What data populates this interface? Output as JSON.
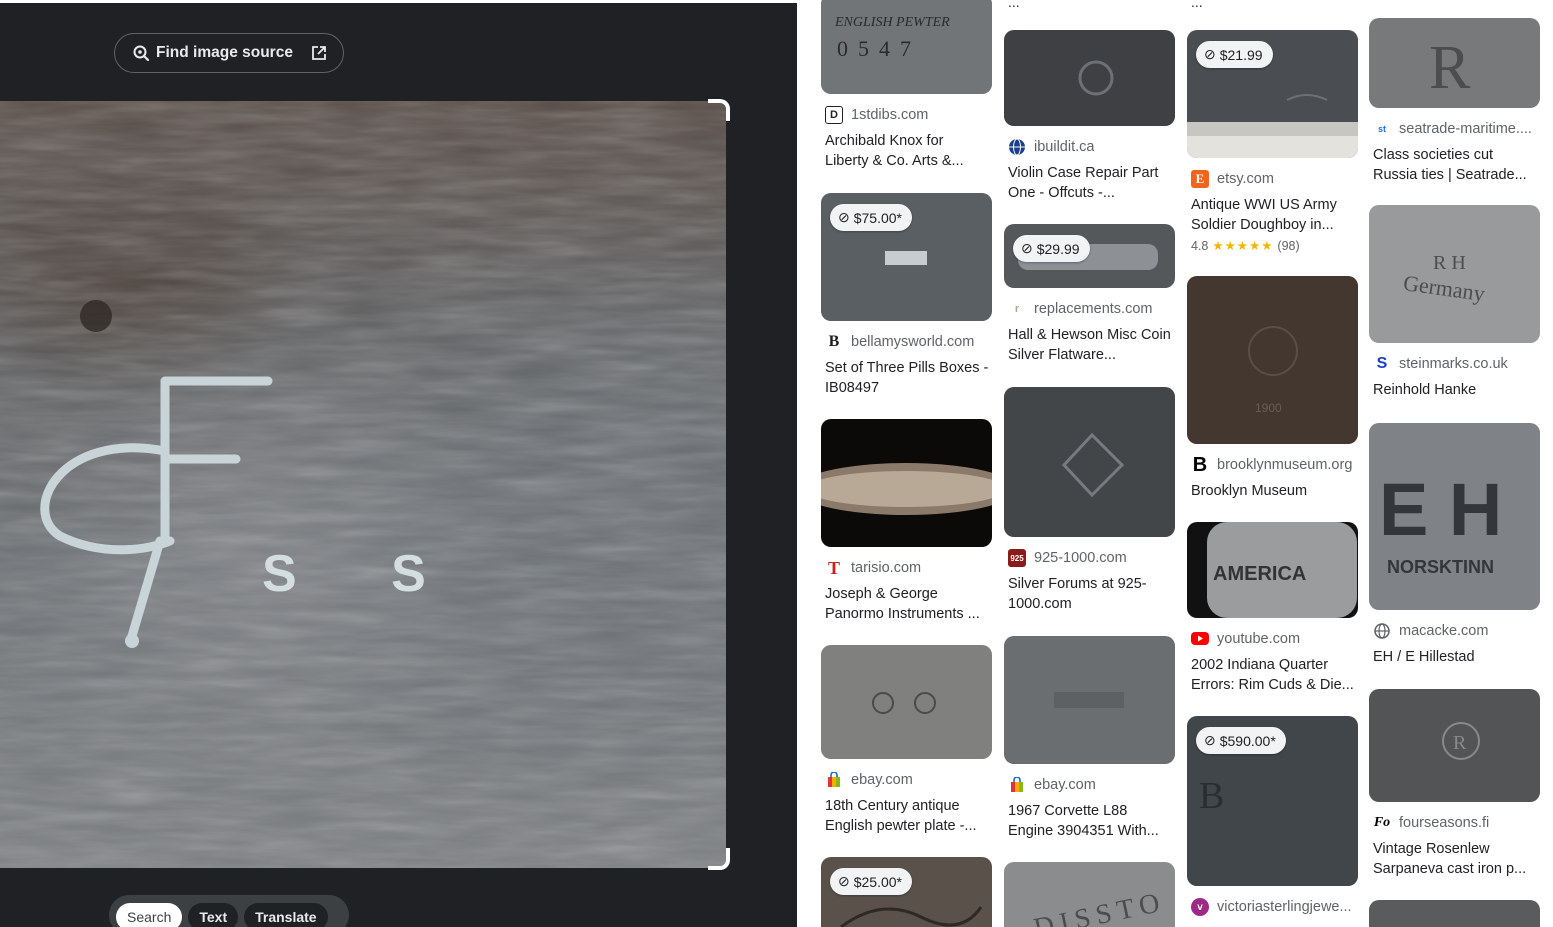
{
  "left_panel": {
    "find_source_label": "Find image source",
    "query_image": {
      "mark_letters": "S S"
    },
    "modes": [
      {
        "label": "Search",
        "active": true
      },
      {
        "label": "Text",
        "active": false
      },
      {
        "label": "Translate",
        "active": false
      }
    ]
  },
  "results": {
    "columns": [
      [
        {
          "thumb_text": "ENGLISH PEWTER 0547",
          "source": "1stdibs.com",
          "favicon": "D",
          "title": "Archibald Knox for Liberty & Co. Arts &..."
        },
        {
          "price": "$75.00*",
          "source": "bellamysworld.com",
          "favicon": "B",
          "title": "Set of Three Pills Boxes - IB08497"
        },
        {
          "source": "tarisio.com",
          "favicon": "T",
          "title": "Joseph & George Panormo Instruments ..."
        },
        {
          "source": "ebay.com",
          "favicon": "bag",
          "title": "18th Century antique English pewter plate -..."
        },
        {
          "price": "$25.00*"
        }
      ],
      [
        {
          "source": "ibuildit.ca",
          "favicon": "globe",
          "title": "Violin Case Repair Part One - Offcuts -..."
        },
        {
          "price": "$29.99",
          "source": "replacements.com",
          "favicon": "r",
          "title": "Hall & Hewson Misc Coin Silver Flatware..."
        },
        {
          "source": "925-1000.com",
          "favicon": "925",
          "title": "Silver Forums at 925-1000.com"
        },
        {
          "source": "ebay.com",
          "favicon": "bag",
          "title": "1967 Corvette L88 Engine 3904351 With..."
        },
        {
          "thumb_text": "DISSTO"
        }
      ],
      [
        {
          "price": "$21.99",
          "source": "etsy.com",
          "favicon": "E",
          "title": "Antique WWI US Army Soldier Doughboy in...",
          "rating": "4.8",
          "stars": "★★★★★",
          "reviews": "(98)"
        },
        {
          "source": "brooklynmuseum.org",
          "favicon": "B",
          "title": "Brooklyn Museum"
        },
        {
          "thumb_text": "AMERICA",
          "source": "youtube.com",
          "favicon": "yt",
          "title": "2002 Indiana Quarter Errors: Rim Cuds & Die..."
        },
        {
          "price": "$590.00*",
          "source": "victoriasterlingjewe...",
          "favicon": "v"
        }
      ],
      [
        {
          "thumb_text": "R",
          "source": "seatrade-maritime....",
          "favicon": "st",
          "title": "Class societies cut Russia ties | Seatrade..."
        },
        {
          "thumb_text": "R H Germany",
          "source": "steinmarks.co.uk",
          "favicon": "S",
          "title": "Reinhold Hanke"
        },
        {
          "thumb_text": "E H NORSKTINN",
          "source": "macacke.com",
          "favicon": "globe",
          "title": "EH / E Hillestad"
        },
        {
          "thumb_text": "R",
          "source": "fourseasons.fi",
          "favicon": "Fo",
          "title": "Vintage Rosenlew Sarpaneva cast iron p..."
        }
      ]
    ],
    "clipped_snippets": [
      "...",
      "..."
    ]
  }
}
